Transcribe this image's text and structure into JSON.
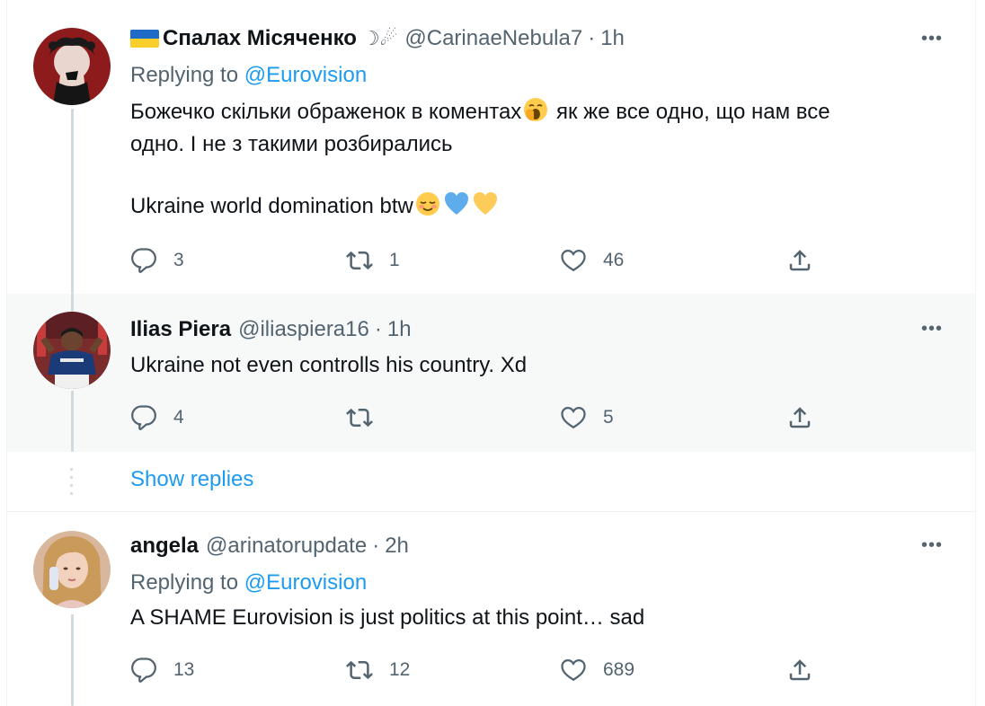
{
  "tweets": [
    {
      "name": "Спалах Місяченко",
      "name_decoration": "☽☄",
      "handle": "@CarinaeNebula7",
      "separator": "·",
      "time": "1h",
      "replying_prefix": "Replying to",
      "replying_to": "@Eurovision",
      "text_lines": [
        "Божечко скільки ображенок в коментах",
        "як же все одно, що нам все",
        "одно. І не з такими розбирались",
        "Ukraine world domination btw"
      ],
      "emoji": [
        "yawning-face",
        "relieved-face",
        "blue-heart",
        "yellow-heart"
      ],
      "reply_count": "3",
      "retweet_count": "1",
      "like_count": "46"
    },
    {
      "name": "Ilias Piera",
      "handle": "@iliaspiera16",
      "separator": "·",
      "time": "1h",
      "text": "Ukraine not even controlls his country. Xd",
      "reply_count": "4",
      "retweet_count": "",
      "like_count": "5"
    },
    {
      "name": "angela",
      "handle": "@arinatorupdate",
      "separator": "·",
      "time": "2h",
      "replying_prefix": "Replying to",
      "replying_to": "@Eurovision",
      "text": "A SHAME Eurovision is just politics at this point… sad",
      "reply_count": "13",
      "retweet_count": "12",
      "like_count": "689"
    }
  ],
  "show_replies_label": "Show replies",
  "more_label": "•••",
  "icons": {
    "reply": "reply-icon",
    "retweet": "retweet-icon",
    "like": "like-icon",
    "share": "share-icon",
    "more": "more-icon",
    "flag": "ukraine-flag-icon"
  },
  "colors": {
    "link": "#1d9bf0",
    "secondary_text": "#536471",
    "primary_text": "#0f1419",
    "highlight_bg": "#f7f9f9"
  }
}
